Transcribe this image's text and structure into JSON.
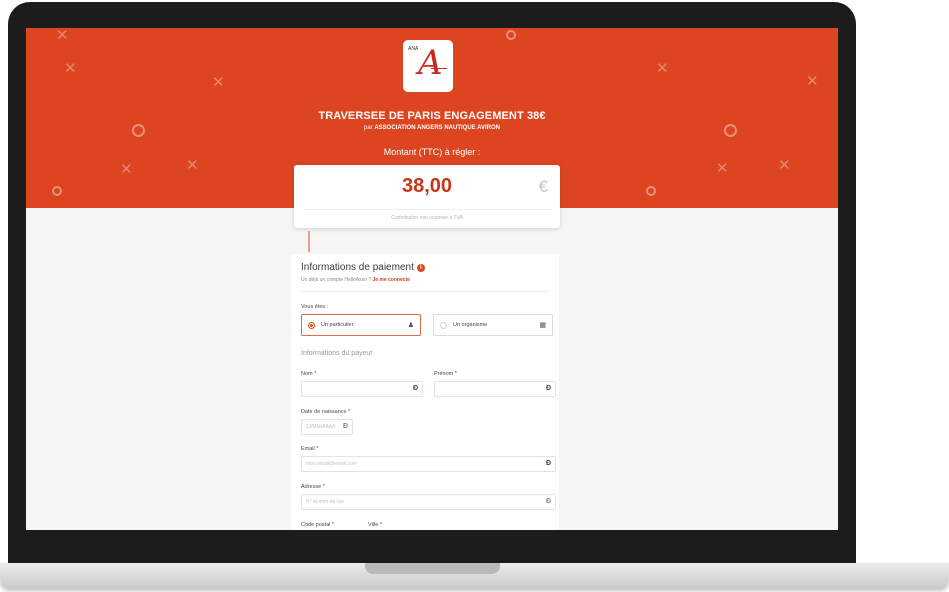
{
  "campaign": {
    "title": "TRAVERSEE DE PARIS ENGAGEMENT 38€",
    "by_prefix": "par",
    "organization": "ASSOCIATION ANGERS NAUTIQUE AVIRON",
    "logo_letter": "A",
    "logo_text": "ANA"
  },
  "amount": {
    "label": "Montant (TTC) à régler :",
    "value": "38,00",
    "currency": "€",
    "note": "Contribution non soumise à TVA"
  },
  "form": {
    "title": "Informations de paiement",
    "info_icon": "i",
    "account_prompt": "Un déjà un compte HelloAsso ?",
    "login_link": "Je me connecte",
    "you_are_label": "Vous êtes :",
    "options": [
      {
        "label": "Un particulier",
        "icon": "person-icon",
        "selected": true
      },
      {
        "label": "Un organisme",
        "icon": "building-icon",
        "selected": false
      }
    ],
    "payer_section": "Informations du payeur",
    "fields": {
      "nom": {
        "label": "Nom *",
        "placeholder": ""
      },
      "prenom": {
        "label": "Prénom *",
        "placeholder": ""
      },
      "birth": {
        "label": "Date de naissance *",
        "placeholder": "JJ/MM/AAAA"
      },
      "email": {
        "label": "Email *",
        "placeholder": "mon.email@email.com"
      },
      "address": {
        "label": "Adresse *",
        "placeholder": "N° et nom de rue"
      },
      "postal": {
        "label": "Code postal *"
      },
      "city": {
        "label": "Ville *"
      }
    }
  },
  "colors": {
    "banner": "#dc4520",
    "accent": "#e0471c",
    "amount": "#c8361a"
  }
}
